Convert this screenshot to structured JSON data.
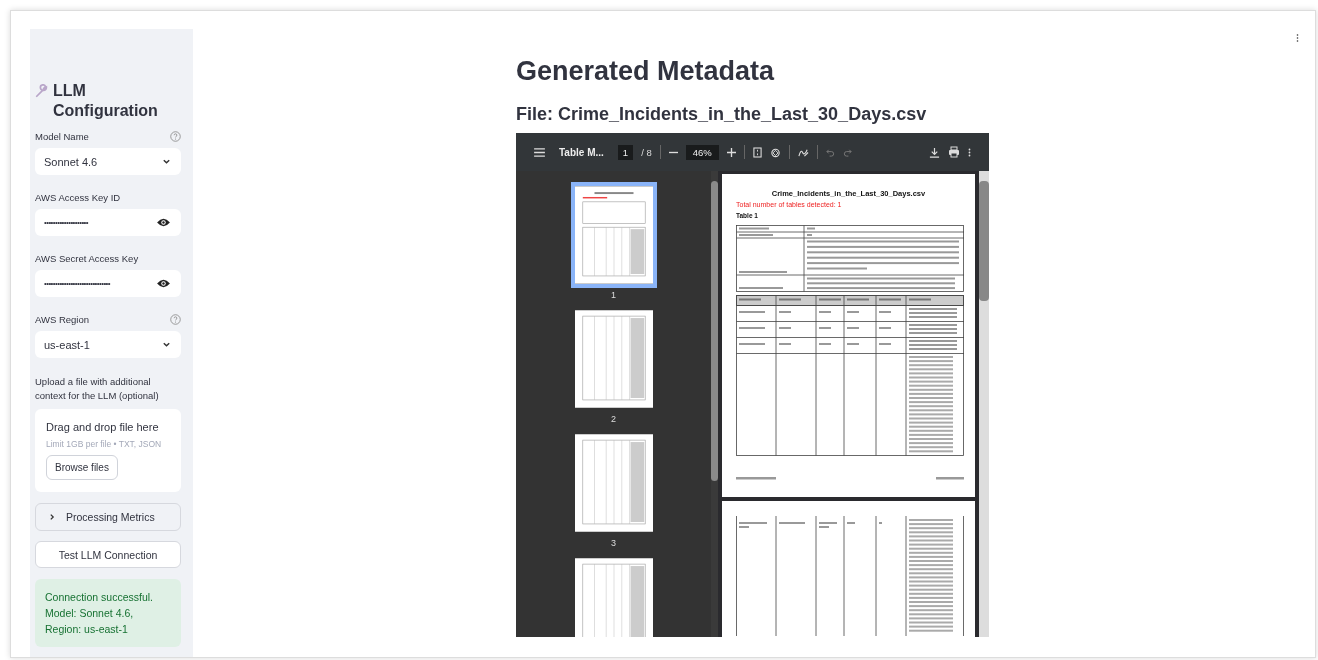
{
  "sidebar": {
    "title": "LLM Configuration",
    "fields": [
      {
        "kind": "select",
        "label": "Model Name",
        "help": true,
        "value": "Sonnet 4.6"
      },
      {
        "kind": "password",
        "label": "AWS Access Key ID",
        "help": false,
        "value": "••••••••••••••••••••"
      },
      {
        "kind": "password",
        "label": "AWS Secret Access Key",
        "help": false,
        "value": "••••••••••••••••••••••••••••••"
      },
      {
        "kind": "select",
        "label": "AWS Region",
        "help": true,
        "value": "us-east-1"
      }
    ],
    "upload": {
      "label": "Upload a file with additional context for the LLM (optional)",
      "title": "Drag and drop file here",
      "limit": "Limit 1GB per file • TXT, JSON",
      "button": "Browse files"
    },
    "expander": {
      "label": "Processing Metrics",
      "expanded": false
    },
    "test_button": "Test LLM Connection",
    "status": "Connection successful. Model: Sonnet 4.6, Region: us-east-1"
  },
  "main": {
    "title": "Generated Metadata",
    "file_heading": "File: Crime_Incidents_in_the_Last_30_Days.csv"
  },
  "pdf_viewer": {
    "toolbar": {
      "title": "Table M...",
      "page": "1",
      "page_total": "/ 8",
      "zoom": "46%"
    },
    "thumbnails": [
      {
        "label": "1",
        "selected": true
      },
      {
        "label": "2",
        "selected": false
      },
      {
        "label": "3",
        "selected": false
      },
      {
        "selected": false
      }
    ],
    "page": {
      "title": "Crime_Incidents_in_the_Last_30_Days.csv",
      "note": "Total number of tables detected: 1",
      "table_title": "Table 1"
    }
  }
}
